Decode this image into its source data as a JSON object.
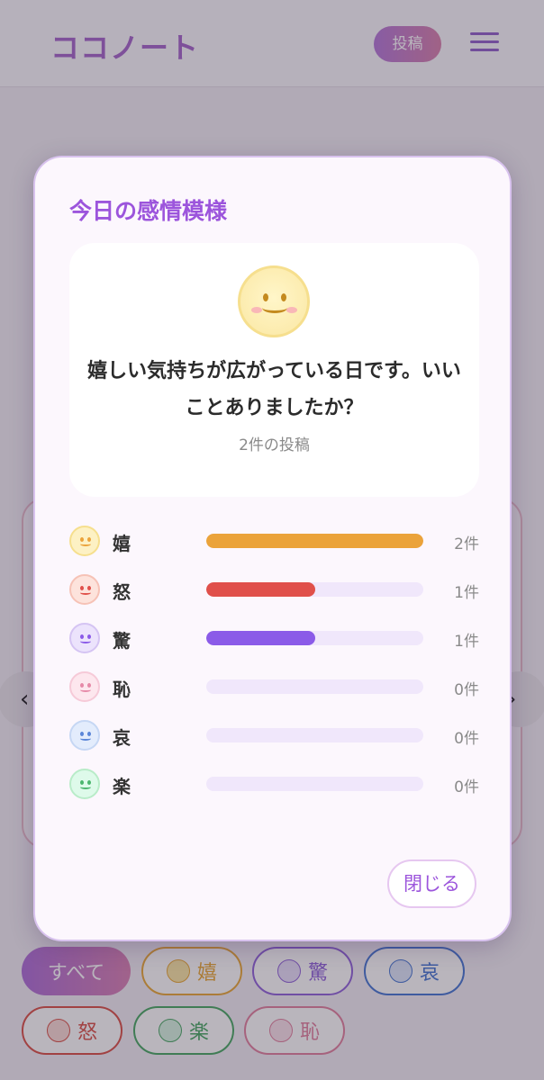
{
  "app": {
    "logo": "ココノート",
    "post_label": "投稿"
  },
  "nav": {
    "prev_glyph": "‹",
    "next_glyph": "›"
  },
  "filters": {
    "all_label": "すべて",
    "chips": [
      {
        "label": "嬉",
        "color": "#e8a32a",
        "face_color": "#fbe6a0"
      },
      {
        "label": "驚",
        "color": "#8a5ad8",
        "face_color": "#e7defa"
      },
      {
        "label": "哀",
        "color": "#3a6fd0",
        "face_color": "#dbe6fb"
      },
      {
        "label": "怒",
        "color": "#d8463c",
        "face_color": "#fbd9d3"
      },
      {
        "label": "楽",
        "color": "#3ca45a",
        "face_color": "#d6f4e0"
      },
      {
        "label": "恥",
        "color": "#e07a9a",
        "face_color": "#fbe0ea"
      }
    ]
  },
  "modal": {
    "title": "今日の感情模様",
    "summary_text": "嬉しい気持ちが広がっている日です。いいことありましたか？",
    "summary_count": "2件の投稿",
    "emotions": [
      {
        "label": "嬉",
        "count": "2件",
        "ratio": 1.0,
        "bar_color": "#eba33a",
        "face_color": "#fdf1c4",
        "face_border": "#f6df8e"
      },
      {
        "label": "怒",
        "count": "1件",
        "ratio": 0.5,
        "bar_color": "#e0504a",
        "face_color": "#fde3dc",
        "face_border": "#f6c2b6"
      },
      {
        "label": "驚",
        "count": "1件",
        "ratio": 0.5,
        "bar_color": "#8b5be8",
        "face_color": "#ece3fc",
        "face_border": "#d5c4f3"
      },
      {
        "label": "恥",
        "count": "0件",
        "ratio": 0.0,
        "bar_color": "#e68aa8",
        "face_color": "#fde7ee",
        "face_border": "#f6cad8"
      },
      {
        "label": "哀",
        "count": "0件",
        "ratio": 0.0,
        "bar_color": "#5b86d8",
        "face_color": "#e3ecfc",
        "face_border": "#c6d7f4"
      },
      {
        "label": "楽",
        "count": "0件",
        "ratio": 0.0,
        "bar_color": "#4cb66e",
        "face_color": "#defaea",
        "face_border": "#b9ecc9"
      }
    ],
    "close_label": "閉じる"
  }
}
